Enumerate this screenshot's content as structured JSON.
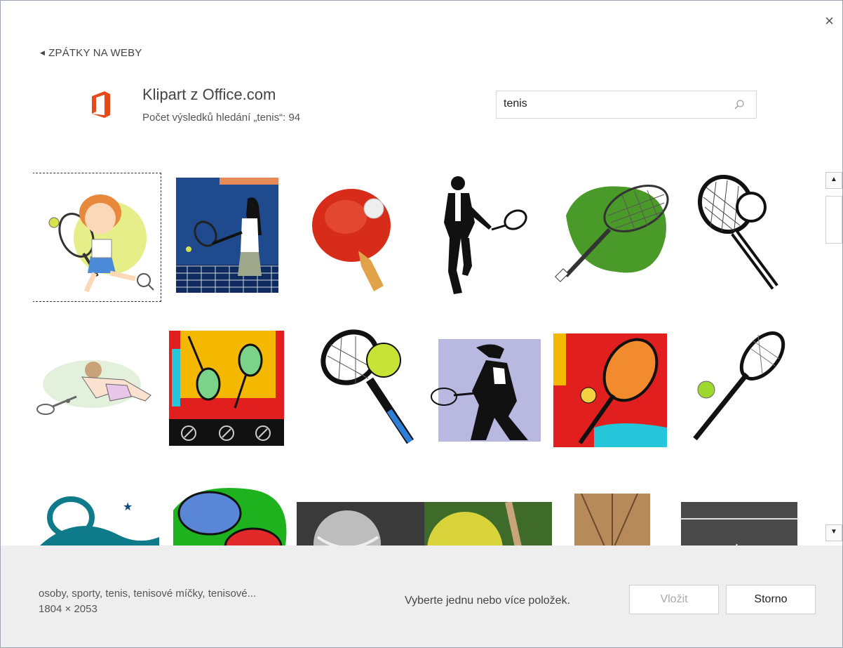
{
  "dialog": {
    "close_label": "×"
  },
  "nav": {
    "back_label": "ZPÁTKY NA WEBY"
  },
  "provider": {
    "title": "Klipart z Office.com",
    "result_count_text": "Počet výsledků hledání „tenis“: 94",
    "logo_color": "#e64a19"
  },
  "search": {
    "value": "tenis",
    "placeholder": ""
  },
  "results": {
    "items": [
      {
        "name": "girl-tennis-player-clipart",
        "selected": true
      },
      {
        "name": "woman-at-tennis-net-clipart"
      },
      {
        "name": "ping-pong-paddle-clipart"
      },
      {
        "name": "tennis-player-silhouette-clipart"
      },
      {
        "name": "green-racket-clipart"
      },
      {
        "name": "racket-and-ball-clipart"
      },
      {
        "name": "diving-tennis-player-clipart"
      },
      {
        "name": "rackets-yellow-poster-clipart"
      },
      {
        "name": "racket-and-green-ball-clipart"
      },
      {
        "name": "player-silhouette-lavender-clipart"
      },
      {
        "name": "orange-racket-red-poster-clipart"
      },
      {
        "name": "racket-and-ball-diagonal-clipart"
      },
      {
        "name": "blue-wave-tennis-clipart"
      },
      {
        "name": "table-tennis-paddles-clipart"
      },
      {
        "name": "ball-photo-grayscale"
      },
      {
        "name": "yellow-ball-photo"
      },
      {
        "name": "racket-strings-photo"
      },
      {
        "name": "tennis-court-photo"
      }
    ]
  },
  "footer": {
    "selected_keywords": "osoby, sporty, tenis, tenisové míčky, tenisové...",
    "selected_size": "1804 × 2053",
    "hint": "Vyberte jednu nebo více položek.",
    "insert_label": "Vložit",
    "cancel_label": "Storno"
  },
  "colors": {
    "footer_bg": "#eeeeee",
    "office_orange": "#e64a19",
    "disabled_text": "#a8a8a8"
  }
}
